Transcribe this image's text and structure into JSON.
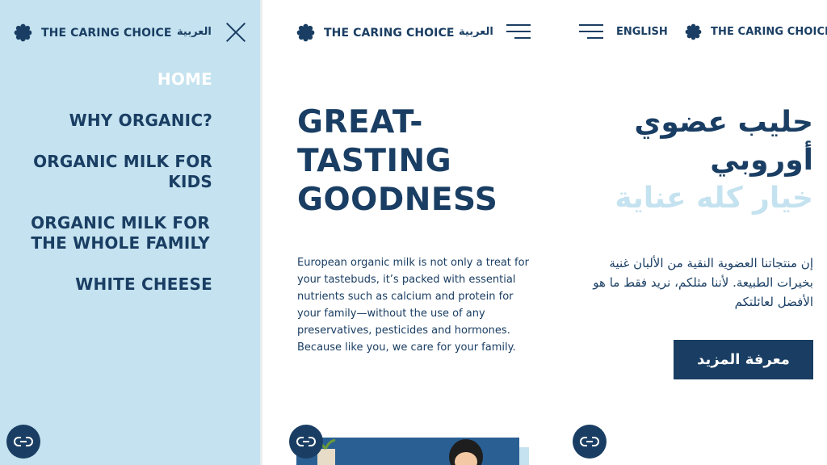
{
  "brand": {
    "name": "THE CARING CHOICE",
    "logo_icon": "flower-icon",
    "color_primary": "#1a3e63",
    "color_light": "#c4e2ef"
  },
  "menu_panel": {
    "language_link": "العربية",
    "close_icon": "close-icon",
    "items": [
      {
        "label": "HOME",
        "active": true
      },
      {
        "label": "WHY ORGANIC?"
      },
      {
        "label": "ORGANIC MILK FOR KIDS"
      },
      {
        "label": "ORGANIC MILK FOR THE WHOLE FAMILY"
      },
      {
        "label": "WHITE CHEESE"
      }
    ]
  },
  "english_panel": {
    "language_link": "العربية",
    "menu_icon": "hamburger-icon",
    "hero_title_lines": [
      "GREAT-",
      "TASTING",
      "GOODNESS"
    ],
    "hero_body": "European organic milk is not only a treat for your tastebuds, it’s packed with essential nutrients such as calcium and protein for your family—without the use of any preservatives, pesticides and hormones. Because like you, we care for your family."
  },
  "arabic_panel": {
    "language_link": "ENGLISH",
    "menu_icon": "hamburger-icon",
    "title_lines": [
      "حليب عضوي",
      "أوروبي"
    ],
    "title_highlight": "خيار كله عناية",
    "body": "إن منتجاتنا العضوية النقية من الألبان غنية بخيرات الطبيعة. لأننا مثلكم، نريد فقط ما هو الأفضل لعائلتكم",
    "cta_label": "معرفة المزيد"
  },
  "chat_widget": {
    "icon": "chat-icon"
  }
}
